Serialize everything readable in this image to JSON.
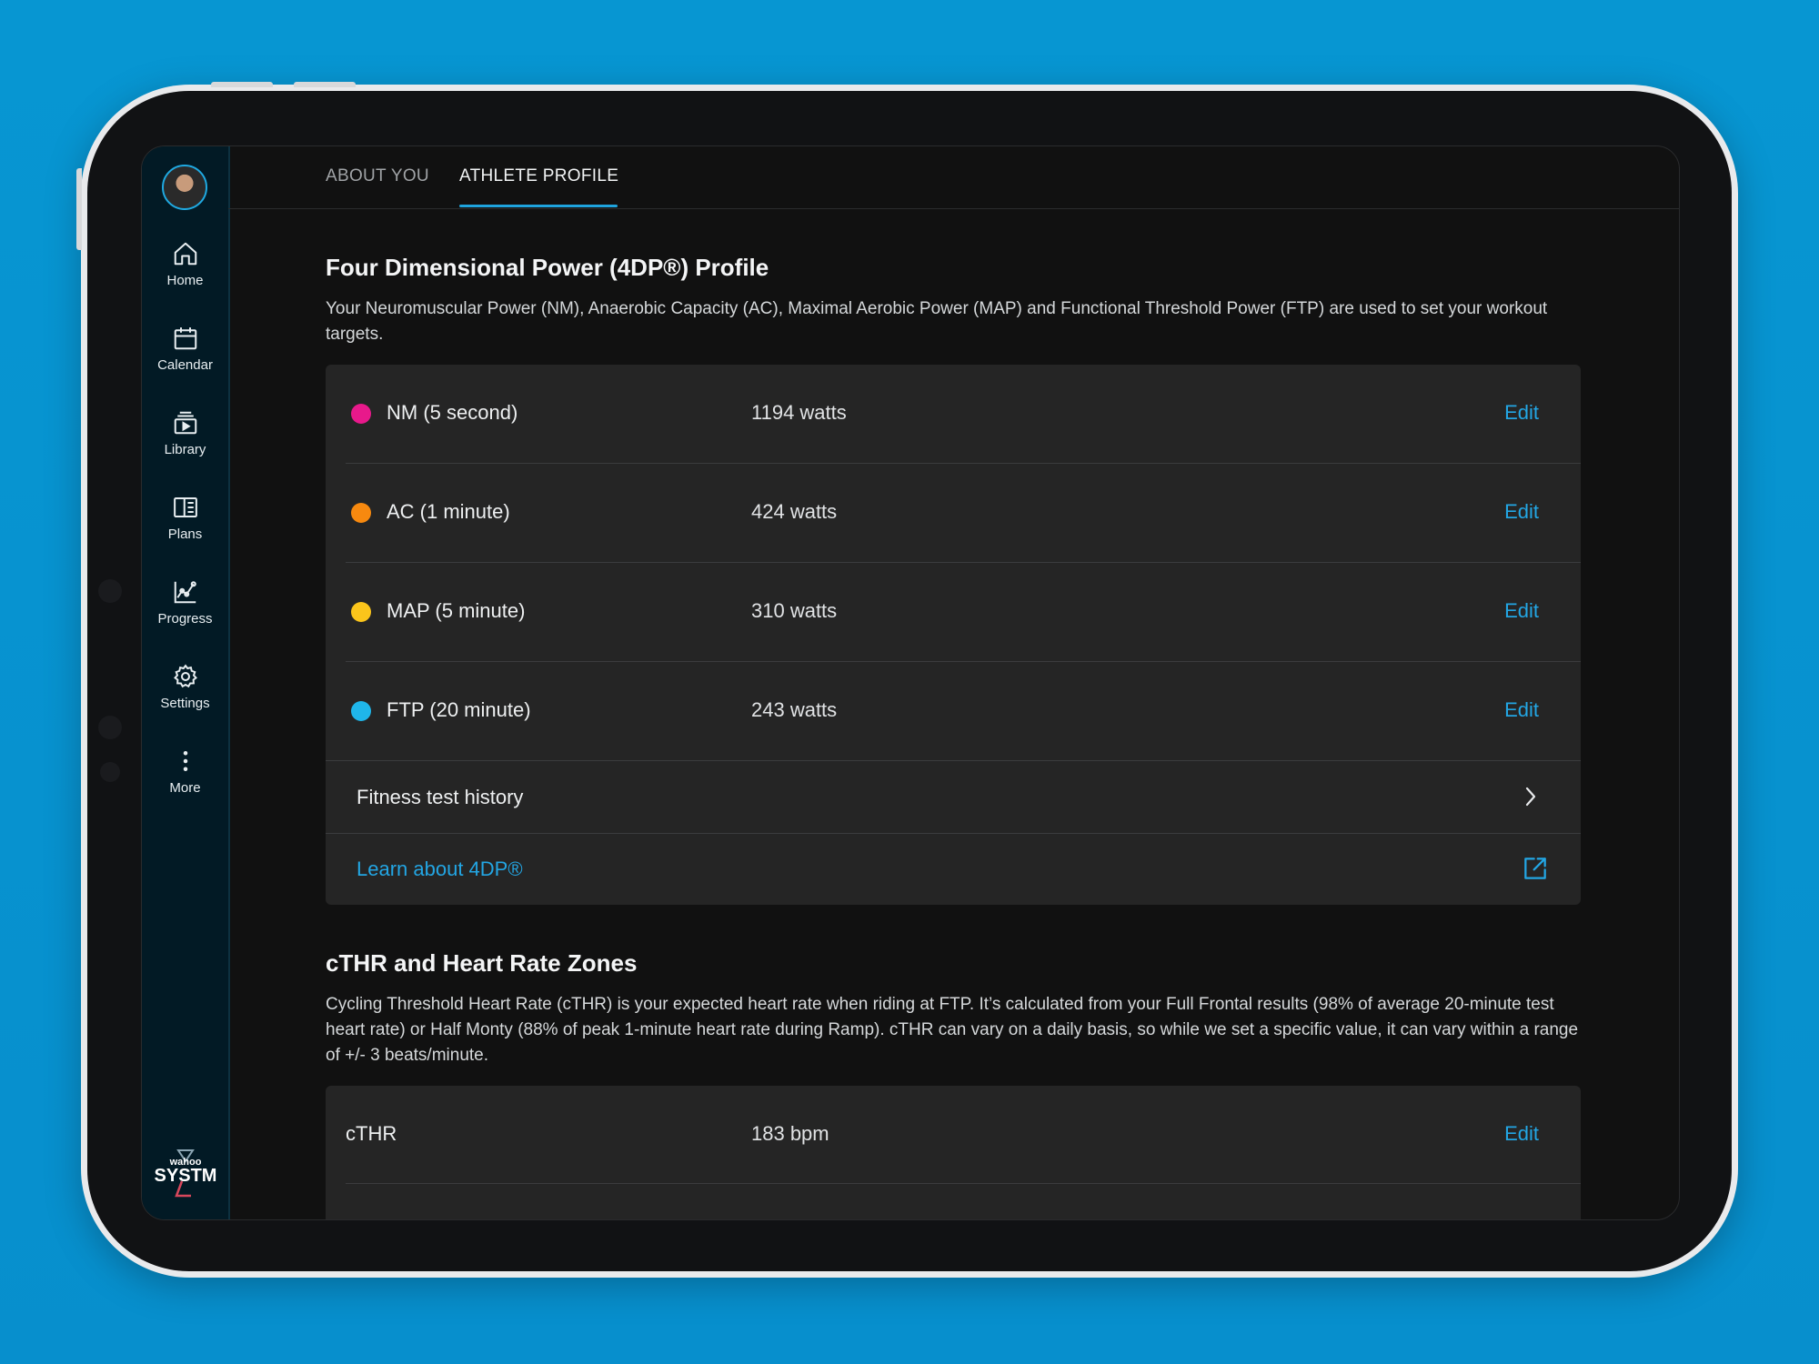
{
  "sidebar": {
    "items": [
      {
        "label": "Home",
        "icon": "home-icon"
      },
      {
        "label": "Calendar",
        "icon": "calendar-icon"
      },
      {
        "label": "Library",
        "icon": "library-icon"
      },
      {
        "label": "Plans",
        "icon": "plans-icon"
      },
      {
        "label": "Progress",
        "icon": "progress-icon"
      },
      {
        "label": "Settings",
        "icon": "gear-icon"
      },
      {
        "label": "More",
        "icon": "more-vertical-icon"
      }
    ],
    "brand": {
      "top": "wahoo",
      "bottom": "SYSTM"
    }
  },
  "tabs": [
    {
      "label": "ABOUT YOU",
      "active": false
    },
    {
      "label": "ATHLETE PROFILE",
      "active": true
    }
  ],
  "power": {
    "title": "Four Dimensional Power (4DP®) Profile",
    "description": "Your Neuromuscular Power (NM), Anaerobic Capacity (AC), Maximal Aerobic Power (MAP) and Functional Threshold Power (FTP) are used to set your workout targets.",
    "rows": [
      {
        "label": "NM (5 second)",
        "value": "1194 watts",
        "action": "Edit",
        "color": "#e8198b"
      },
      {
        "label": "AC (1 minute)",
        "value": "424 watts",
        "action": "Edit",
        "color": "#f7890f"
      },
      {
        "label": "MAP (5 minute)",
        "value": "310 watts",
        "action": "Edit",
        "color": "#fbc51b"
      },
      {
        "label": "FTP (20 minute)",
        "value": "243 watts",
        "action": "Edit",
        "color": "#1fb6ea"
      }
    ],
    "history_label": "Fitness test history",
    "learn_label": "Learn about 4DP®"
  },
  "hr": {
    "title": "cTHR and Heart Rate Zones",
    "description": "Cycling Threshold Heart Rate (cTHR) is your expected heart rate when riding at FTP. It’s calculated from your Full Frontal results (98% of average 20-minute test heart rate) or Half Monty (88% of peak 1-minute heart rate during Ramp). cTHR can vary on a daily basis, so while we set a specific value, it can vary within a range of +/- 3 beats/minute.",
    "rows": [
      {
        "label": "cTHR",
        "value": "183 bpm",
        "action": "Edit"
      }
    ]
  },
  "colors": {
    "accent": "#23a6e4",
    "sidebar_bg": "#021a25",
    "card_bg": "#252525",
    "backdrop": "#0796d2"
  }
}
